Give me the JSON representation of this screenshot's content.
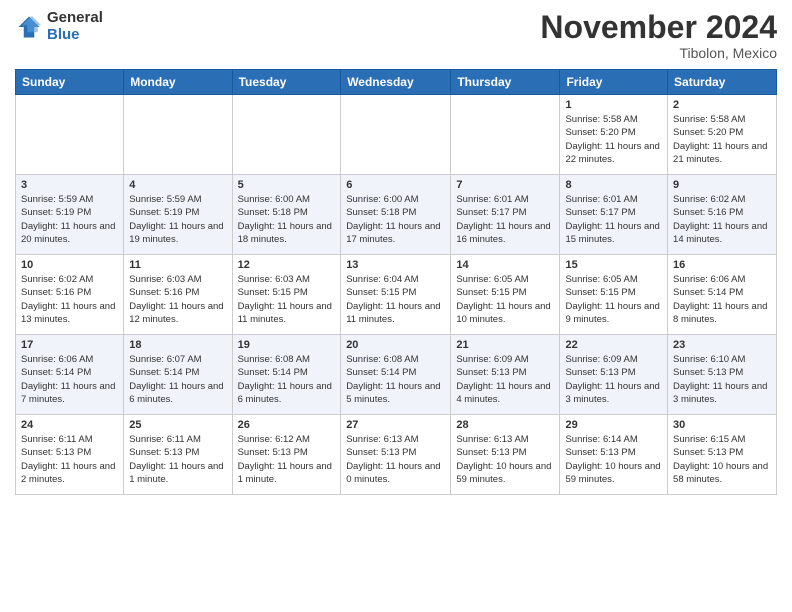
{
  "logo": {
    "general": "General",
    "blue": "Blue"
  },
  "header": {
    "month": "November 2024",
    "location": "Tibolon, Mexico"
  },
  "weekdays": [
    "Sunday",
    "Monday",
    "Tuesday",
    "Wednesday",
    "Thursday",
    "Friday",
    "Saturday"
  ],
  "weeks": [
    [
      {
        "day": "",
        "info": ""
      },
      {
        "day": "",
        "info": ""
      },
      {
        "day": "",
        "info": ""
      },
      {
        "day": "",
        "info": ""
      },
      {
        "day": "",
        "info": ""
      },
      {
        "day": "1",
        "info": "Sunrise: 5:58 AM\nSunset: 5:20 PM\nDaylight: 11 hours\nand 22 minutes."
      },
      {
        "day": "2",
        "info": "Sunrise: 5:58 AM\nSunset: 5:20 PM\nDaylight: 11 hours\nand 21 minutes."
      }
    ],
    [
      {
        "day": "3",
        "info": "Sunrise: 5:59 AM\nSunset: 5:19 PM\nDaylight: 11 hours\nand 20 minutes."
      },
      {
        "day": "4",
        "info": "Sunrise: 5:59 AM\nSunset: 5:19 PM\nDaylight: 11 hours\nand 19 minutes."
      },
      {
        "day": "5",
        "info": "Sunrise: 6:00 AM\nSunset: 5:18 PM\nDaylight: 11 hours\nand 18 minutes."
      },
      {
        "day": "6",
        "info": "Sunrise: 6:00 AM\nSunset: 5:18 PM\nDaylight: 11 hours\nand 17 minutes."
      },
      {
        "day": "7",
        "info": "Sunrise: 6:01 AM\nSunset: 5:17 PM\nDaylight: 11 hours\nand 16 minutes."
      },
      {
        "day": "8",
        "info": "Sunrise: 6:01 AM\nSunset: 5:17 PM\nDaylight: 11 hours\nand 15 minutes."
      },
      {
        "day": "9",
        "info": "Sunrise: 6:02 AM\nSunset: 5:16 PM\nDaylight: 11 hours\nand 14 minutes."
      }
    ],
    [
      {
        "day": "10",
        "info": "Sunrise: 6:02 AM\nSunset: 5:16 PM\nDaylight: 11 hours\nand 13 minutes."
      },
      {
        "day": "11",
        "info": "Sunrise: 6:03 AM\nSunset: 5:16 PM\nDaylight: 11 hours\nand 12 minutes."
      },
      {
        "day": "12",
        "info": "Sunrise: 6:03 AM\nSunset: 5:15 PM\nDaylight: 11 hours\nand 11 minutes."
      },
      {
        "day": "13",
        "info": "Sunrise: 6:04 AM\nSunset: 5:15 PM\nDaylight: 11 hours\nand 11 minutes."
      },
      {
        "day": "14",
        "info": "Sunrise: 6:05 AM\nSunset: 5:15 PM\nDaylight: 11 hours\nand 10 minutes."
      },
      {
        "day": "15",
        "info": "Sunrise: 6:05 AM\nSunset: 5:15 PM\nDaylight: 11 hours\nand 9 minutes."
      },
      {
        "day": "16",
        "info": "Sunrise: 6:06 AM\nSunset: 5:14 PM\nDaylight: 11 hours\nand 8 minutes."
      }
    ],
    [
      {
        "day": "17",
        "info": "Sunrise: 6:06 AM\nSunset: 5:14 PM\nDaylight: 11 hours\nand 7 minutes."
      },
      {
        "day": "18",
        "info": "Sunrise: 6:07 AM\nSunset: 5:14 PM\nDaylight: 11 hours\nand 6 minutes."
      },
      {
        "day": "19",
        "info": "Sunrise: 6:08 AM\nSunset: 5:14 PM\nDaylight: 11 hours\nand 6 minutes."
      },
      {
        "day": "20",
        "info": "Sunrise: 6:08 AM\nSunset: 5:14 PM\nDaylight: 11 hours\nand 5 minutes."
      },
      {
        "day": "21",
        "info": "Sunrise: 6:09 AM\nSunset: 5:13 PM\nDaylight: 11 hours\nand 4 minutes."
      },
      {
        "day": "22",
        "info": "Sunrise: 6:09 AM\nSunset: 5:13 PM\nDaylight: 11 hours\nand 3 minutes."
      },
      {
        "day": "23",
        "info": "Sunrise: 6:10 AM\nSunset: 5:13 PM\nDaylight: 11 hours\nand 3 minutes."
      }
    ],
    [
      {
        "day": "24",
        "info": "Sunrise: 6:11 AM\nSunset: 5:13 PM\nDaylight: 11 hours\nand 2 minutes."
      },
      {
        "day": "25",
        "info": "Sunrise: 6:11 AM\nSunset: 5:13 PM\nDaylight: 11 hours\nand 1 minute."
      },
      {
        "day": "26",
        "info": "Sunrise: 6:12 AM\nSunset: 5:13 PM\nDaylight: 11 hours\nand 1 minute."
      },
      {
        "day": "27",
        "info": "Sunrise: 6:13 AM\nSunset: 5:13 PM\nDaylight: 11 hours\nand 0 minutes."
      },
      {
        "day": "28",
        "info": "Sunrise: 6:13 AM\nSunset: 5:13 PM\nDaylight: 10 hours\nand 59 minutes."
      },
      {
        "day": "29",
        "info": "Sunrise: 6:14 AM\nSunset: 5:13 PM\nDaylight: 10 hours\nand 59 minutes."
      },
      {
        "day": "30",
        "info": "Sunrise: 6:15 AM\nSunset: 5:13 PM\nDaylight: 10 hours\nand 58 minutes."
      }
    ]
  ]
}
